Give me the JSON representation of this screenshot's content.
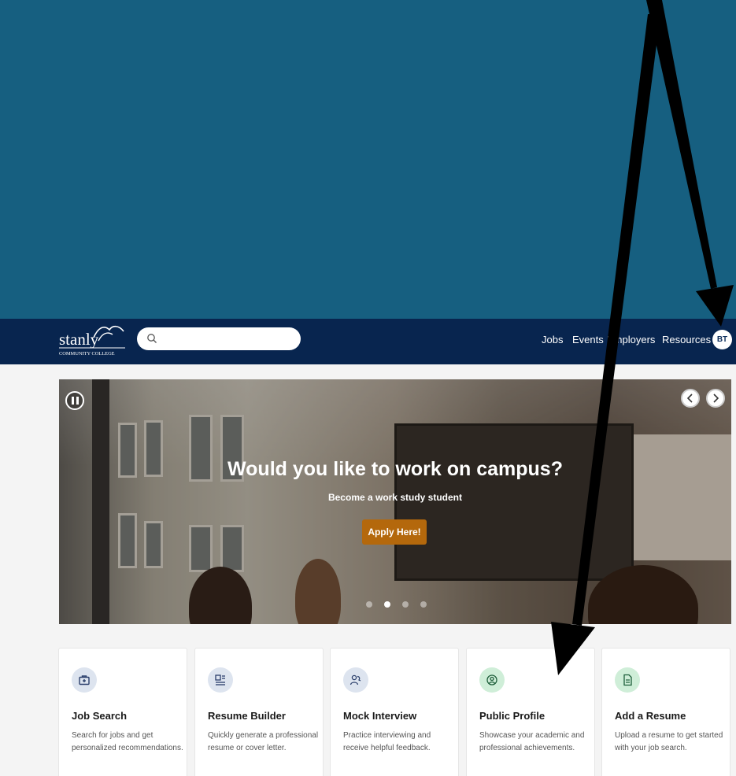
{
  "logo": {
    "text_main": "stanly",
    "text_sub": "COMMUNITY COLLEGE"
  },
  "search": {
    "placeholder": ""
  },
  "nav": {
    "links": [
      {
        "label": "Jobs"
      },
      {
        "label": "Events"
      },
      {
        "label": "Employers"
      },
      {
        "label": "Resources"
      }
    ],
    "avatar_initials": "BT"
  },
  "hero": {
    "title": "Would you like to work on campus?",
    "subtitle": "Become a work study student",
    "button_label": "Apply Here!",
    "slide_count": 4,
    "active_slide": 2
  },
  "cards": [
    {
      "icon": "briefcase-icon",
      "title": "Job Search",
      "description": "Search for jobs and get personalized recommendations."
    },
    {
      "icon": "resume-icon",
      "title": "Resume Builder",
      "description": "Quickly generate a professional resume or cover letter."
    },
    {
      "icon": "interview-icon",
      "title": "Mock Interview",
      "description": "Practice interviewing and receive helpful feedback."
    },
    {
      "icon": "profile-icon",
      "title": "Public Profile",
      "description": "Showcase your academic and professional achievements."
    },
    {
      "icon": "document-icon",
      "title": "Add a Resume",
      "description": "Upload a resume to get started with your job search."
    }
  ],
  "colors": {
    "top_block": "#165f80",
    "navbar": "#08254f",
    "apply_button": "#b4680c",
    "icon_blue_bg": "#dde4ef",
    "icon_green_bg": "#cfeed8"
  }
}
